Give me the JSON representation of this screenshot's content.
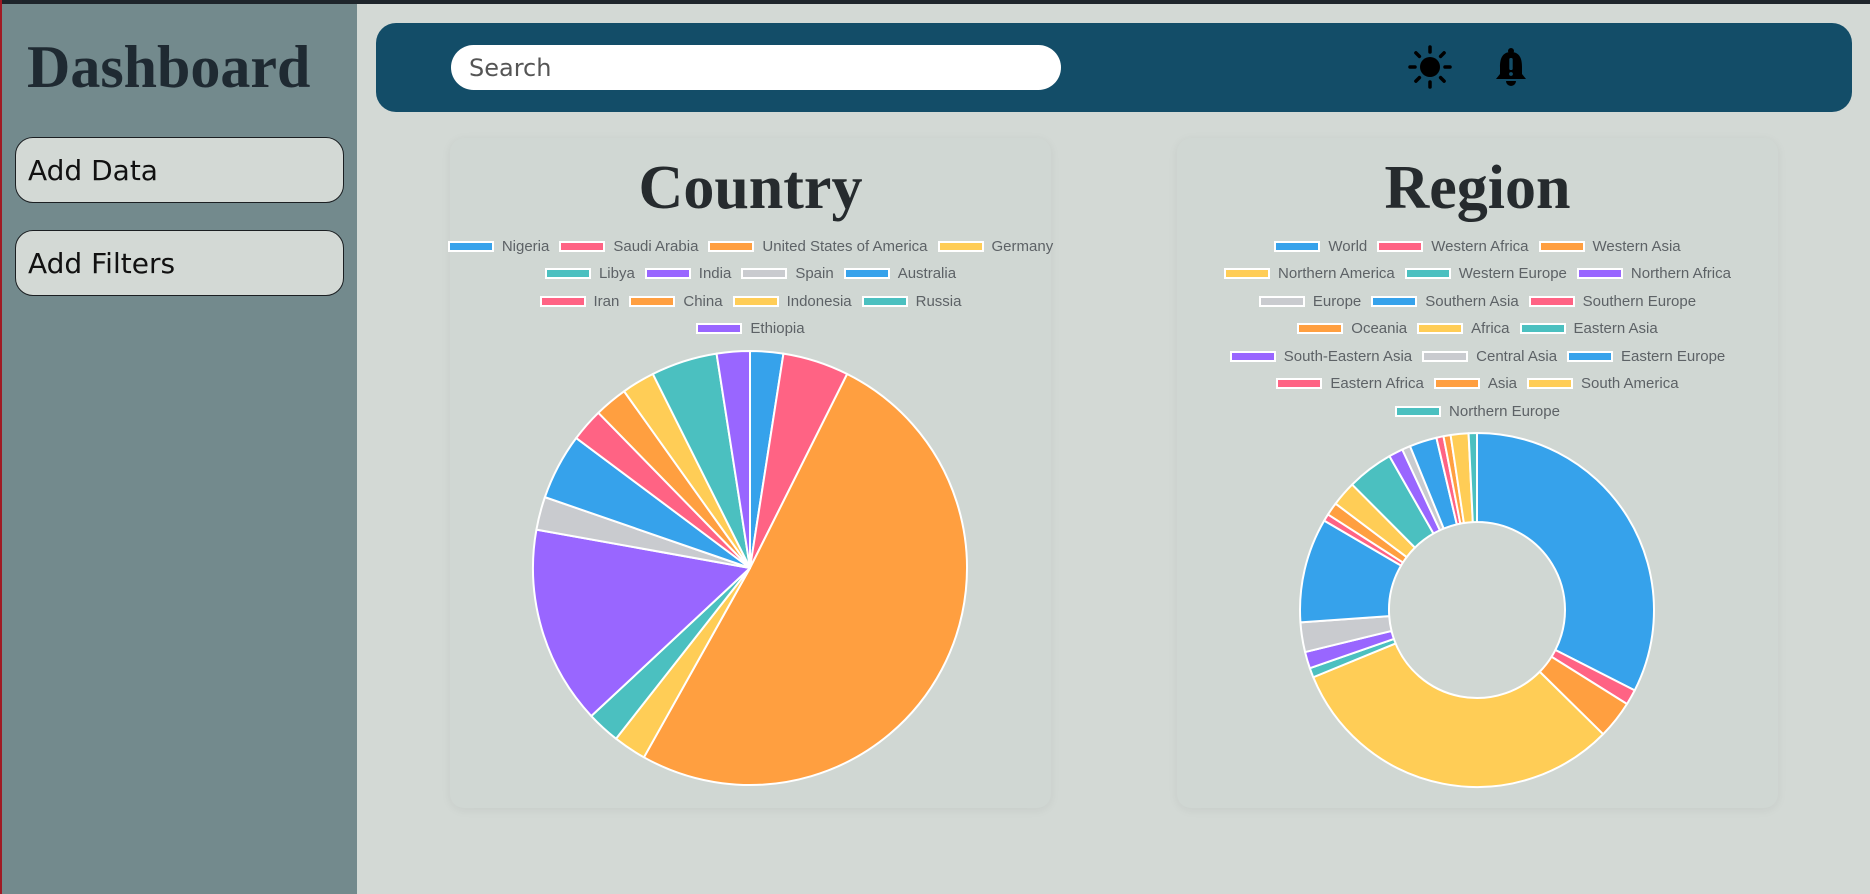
{
  "sidebar": {
    "title": "Dashboard",
    "buttons": [
      "Add Data",
      "Add Filters"
    ]
  },
  "topbar": {
    "search_placeholder": "Search",
    "icons": [
      "sun-icon",
      "bell-alert-icon"
    ]
  },
  "colors": {
    "topbar": "#134d68",
    "sidebar": "#738a8d",
    "background": "#d3d9d5",
    "palette": [
      "#36a2eb",
      "#ff6384",
      "#ff9f40",
      "#ffcd56",
      "#4bc0c0",
      "#9966ff",
      "#c9cbcf"
    ]
  },
  "chart_data": [
    {
      "type": "pie",
      "title": "Country",
      "legend_position": "top",
      "categories": [
        "Nigeria",
        "Saudi Arabia",
        "United States of America",
        "Germany",
        "Libya",
        "India",
        "Spain",
        "Australia",
        "Iran",
        "China",
        "Indonesia",
        "Russia",
        "Ethiopia"
      ],
      "values": [
        2.5,
        5,
        51.5,
        2.5,
        2.5,
        15,
        2.5,
        5,
        2.5,
        2.5,
        2.5,
        5,
        2.5
      ]
    },
    {
      "type": "doughnut",
      "title": "Region",
      "legend_position": "top",
      "categories": [
        "World",
        "Western Africa",
        "Western Asia",
        "Northern America",
        "Western Europe",
        "Northern Africa",
        "Europe",
        "Southern Asia",
        "Southern Europe",
        "Oceania",
        "Africa",
        "Eastern Asia",
        "South-Eastern Asia",
        "Central Asia",
        "Eastern Europe",
        "Eastern Africa",
        "Asia",
        "South America",
        "Northern Europe"
      ],
      "values": [
        30,
        1.3,
        3.2,
        29,
        0.8,
        1.4,
        2.5,
        8.8,
        0.6,
        1.1,
        2.1,
        3.9,
        1.2,
        0.7,
        2.3,
        0.6,
        0.6,
        1.5,
        0.7
      ]
    }
  ]
}
